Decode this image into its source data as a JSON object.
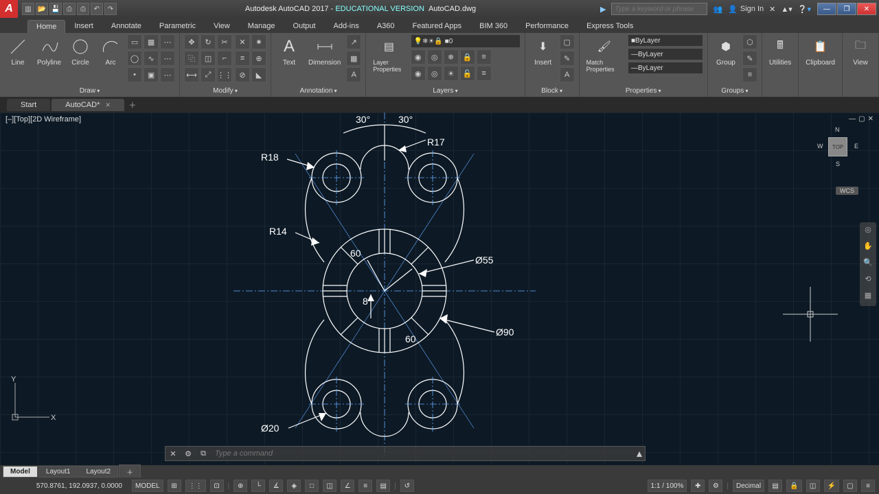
{
  "title": {
    "app": "Autodesk AutoCAD 2017",
    "edition": "EDUCATIONAL VERSION",
    "file": "AutoCAD.dwg"
  },
  "search_placeholder": "Type a keyword or phrase",
  "signin": "Sign In",
  "menu_tabs": [
    "Home",
    "Insert",
    "Annotate",
    "Parametric",
    "View",
    "Manage",
    "Output",
    "Add-ins",
    "A360",
    "Featured Apps",
    "BIM 360",
    "Performance",
    "Express Tools"
  ],
  "active_menu_tab": "Home",
  "ribbon": {
    "draw": {
      "label": "Draw",
      "tools": [
        "Line",
        "Polyline",
        "Circle",
        "Arc"
      ]
    },
    "modify": {
      "label": "Modify"
    },
    "annotation": {
      "label": "Annotation",
      "tools": [
        "Text",
        "Dimension"
      ]
    },
    "layers": {
      "label": "Layers",
      "tool": "Layer Properties",
      "current_layer": "0"
    },
    "block": {
      "label": "Block",
      "tool": "Insert"
    },
    "properties": {
      "label": "Properties",
      "tool": "Match Properties",
      "values": [
        "ByLayer",
        "ByLayer",
        "ByLayer"
      ]
    },
    "groups": {
      "label": "Groups",
      "tool": "Group"
    },
    "utilities": {
      "label": "Utilities"
    },
    "clipboard": {
      "label": "Clipboard"
    },
    "view": {
      "label": "View"
    }
  },
  "file_tabs": [
    "Start",
    "AutoCAD*"
  ],
  "active_file_tab": "AutoCAD*",
  "viewport_label": "[–][Top][2D Wireframe]",
  "viewcube": {
    "face": "TOP",
    "n": "N",
    "s": "S",
    "e": "E",
    "w": "W",
    "wcs": "WCS"
  },
  "dimensions": {
    "ang1": "30°",
    "ang2": "30°",
    "r17": "R17",
    "r18": "R18",
    "r14": "R14",
    "a60_1": "60",
    "a60_2": "60",
    "d8": "8",
    "d55": "Ø55",
    "d90": "Ø90",
    "d20": "Ø20"
  },
  "ucs": {
    "x": "X",
    "y": "Y"
  },
  "cmdline_placeholder": "Type a command",
  "layout_tabs": [
    "Model",
    "Layout1",
    "Layout2"
  ],
  "active_layout": "Model",
  "status": {
    "coords": "570.8761, 192.0937, 0.0000",
    "model": "MODEL",
    "scale": "1:1 / 100%",
    "units": "Decimal"
  }
}
